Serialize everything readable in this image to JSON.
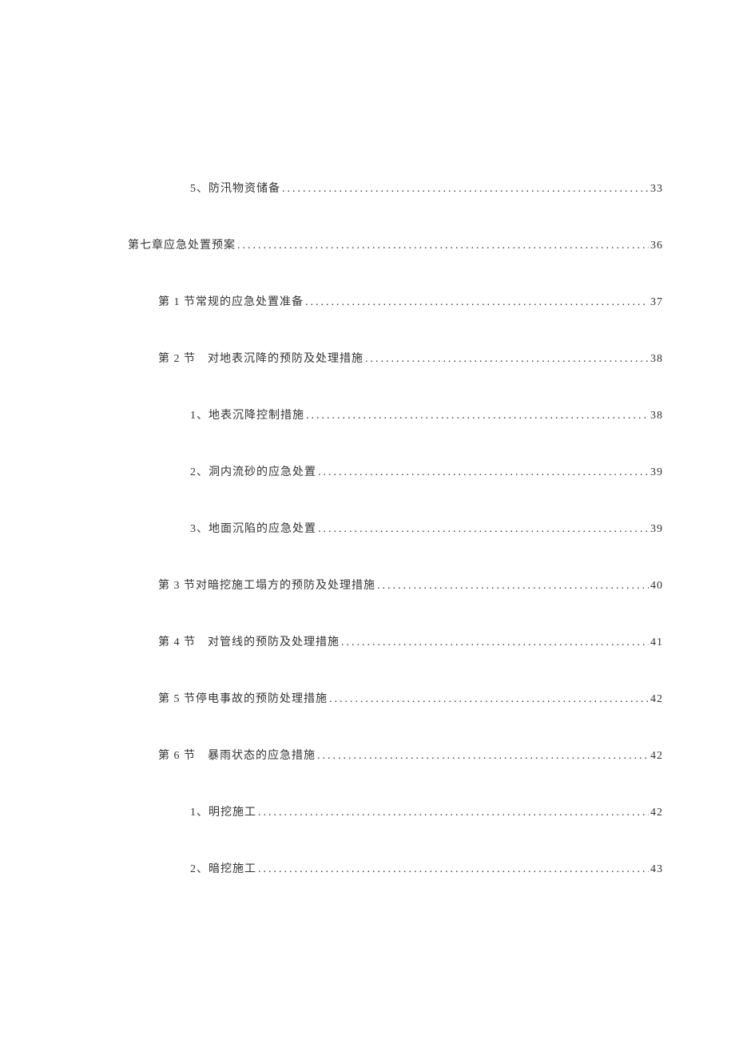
{
  "toc": [
    {
      "level": 2,
      "label": "5、防汛物资储备",
      "page": "33"
    },
    {
      "level": 0,
      "label": "第七章应急处置预案",
      "page": "36"
    },
    {
      "level": 1,
      "label": "第 1 节常规的应急处置准备",
      "page": "37"
    },
    {
      "level": 1,
      "label": "第 2 节　对地表沉降的预防及处理措施",
      "page": "38"
    },
    {
      "level": 2,
      "label": "1、地表沉降控制措施",
      "page": "38"
    },
    {
      "level": 2,
      "label": "2、洞内流砂的应急处置",
      "page": "39"
    },
    {
      "level": 2,
      "label": "3、地面沉陷的应急处置",
      "page": "39"
    },
    {
      "level": 1,
      "label": "第 3 节对暗挖施工塌方的预防及处理措施",
      "page": "40"
    },
    {
      "level": 1,
      "label": "第 4 节　对管线的预防及处理措施",
      "page": "41"
    },
    {
      "level": 1,
      "label": "第 5 节停电事故的预防处理措施",
      "page": "42"
    },
    {
      "level": 1,
      "label": "第 6 节　暴雨状态的应急措施",
      "page": "42"
    },
    {
      "level": 2,
      "label": "1、明挖施工",
      "page": "42"
    },
    {
      "level": 2,
      "label": "2、暗挖施工",
      "page": "43"
    }
  ]
}
